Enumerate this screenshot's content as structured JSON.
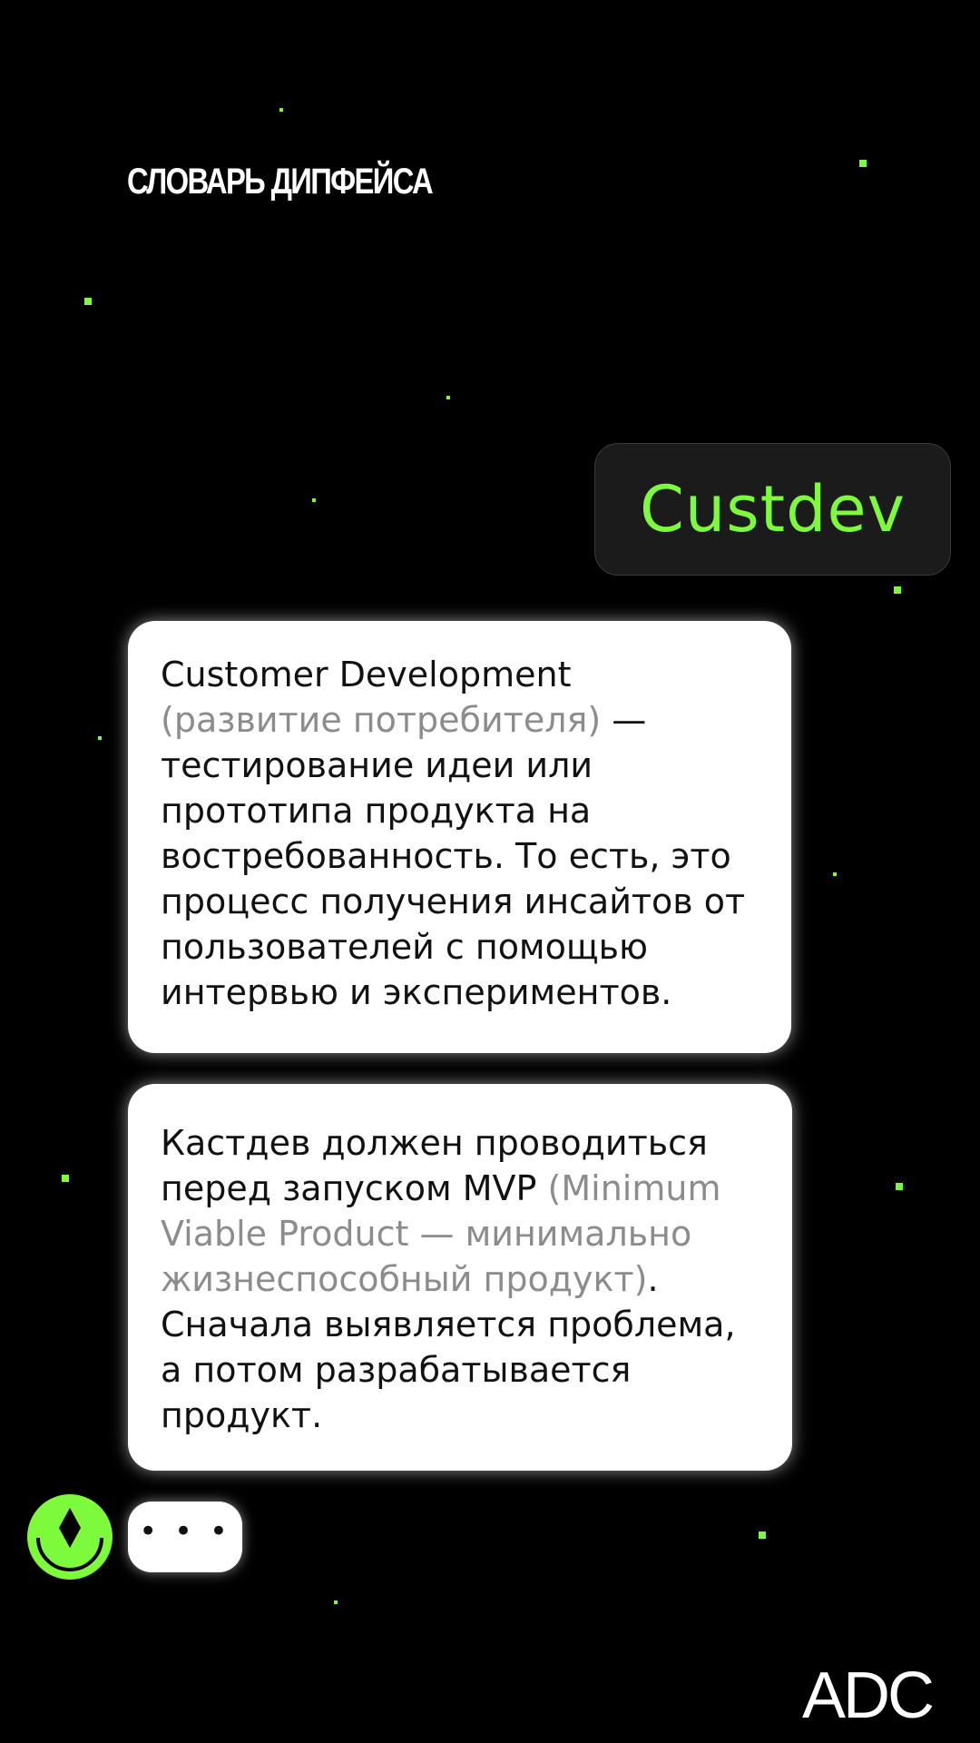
{
  "header": {
    "title": "СЛОВАРЬ ДИПФЕЙСА"
  },
  "term": {
    "label": "Custdev"
  },
  "messages": [
    {
      "intro": "Customer Development",
      "grey": "(развитие потребителя)",
      "text": " — тестирование идеи или прототипа продукта на востребованность. То есть, это процесс получения инсайтов от пользователей с помощью интервью и экспериментов."
    },
    {
      "intro": "Кастдев должен проводиться перед запуском MVP",
      "grey": "(Minimum Viable Product — минимально жизнеспособный продукт)",
      "text": ". Сначала выявляется проблема, а потом разрабатывается продукт."
    }
  ],
  "typing": {
    "dots": "• • •"
  },
  "brand": {
    "logo": "ADC"
  },
  "colors": {
    "background": "#000000",
    "accent": "#7dfa3c",
    "bubble": "#ffffff",
    "term_bubble": "#1b1b1b",
    "muted_text": "#8c8c8c"
  },
  "icons": {
    "avatar": "smiley-diamond-icon"
  }
}
